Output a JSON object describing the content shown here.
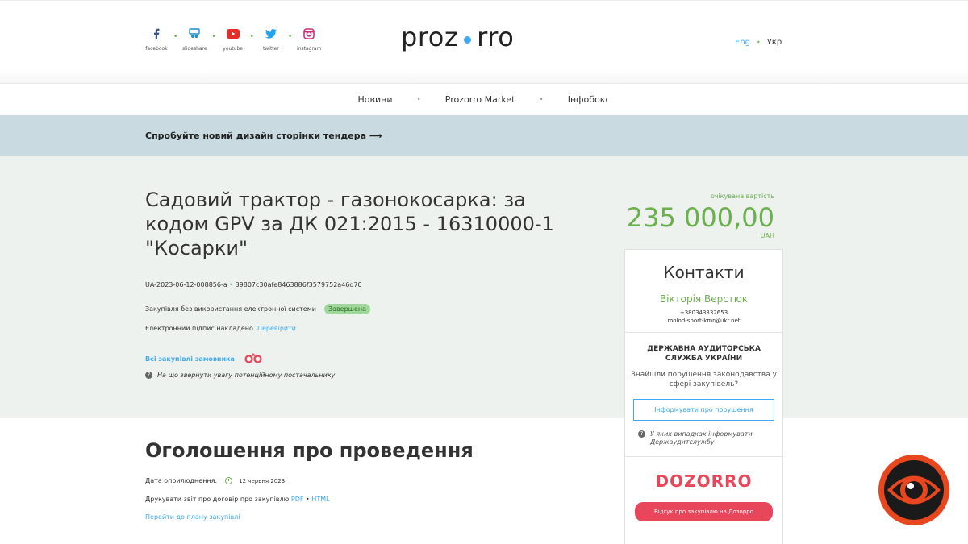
{
  "header": {
    "social": [
      {
        "label": "facebook",
        "icon": "facebook-icon",
        "color": "#3b5998"
      },
      {
        "label": "slideshare",
        "icon": "slideshare-icon",
        "color": "#1f8fc9"
      },
      {
        "label": "youtube",
        "icon": "youtube-icon",
        "color": "#e52d27"
      },
      {
        "label": "twitter",
        "icon": "twitter-icon",
        "color": "#1da1f2"
      },
      {
        "label": "instagram",
        "icon": "instagram-icon",
        "color": "#c13584"
      }
    ],
    "logo_left": "proz",
    "logo_right": "rro",
    "lang_en": "Eng",
    "lang_sep": "•",
    "lang_uk": "Укр"
  },
  "nav": {
    "items": [
      "Новини",
      "Prozorro Market",
      "Інфобокс"
    ],
    "dot": "•"
  },
  "banner": {
    "text": "Спробуйте новий дизайн сторінки тендера ⟶"
  },
  "tender": {
    "title": "Садовий трактор - газонокосарка: за кодом GPV за ДК 021:2015 - 16310000-1 \"Косарки\"",
    "id": "UA-2023-06-12-008856-a",
    "id_sep": "•",
    "hash": "39807c30afe8463886f3579752a46d70",
    "mode": "Закупівля без використання електронної системи",
    "status": "Завершена",
    "sign_text": "Електронний підпис накладено.",
    "sign_link": "Перевірити",
    "all_link": "Всі закупівлі замовника",
    "hint": "На що звернути увагу потенційному постачальнику",
    "price_label": "очікувана вартість",
    "price_value": "235 000,00",
    "price_currency": "UAH"
  },
  "contacts": {
    "title": "Контакти",
    "name": "Вікторія Верстюк",
    "phone": "+380343332653",
    "email": "molod-sport-kmr@ukr.net",
    "org": "ДЕРЖАВНА АУДИТОРСЬКА СЛУЖБА УКРАЇНИ",
    "question": "Знайшли порушення законодавства у сфері закупівель?",
    "report_button": "Інформувати про порушення",
    "note": "У яких випадках інформувати Держаудитслужбу",
    "dozorro": "DOZORRO",
    "dozorro_button": "Відгук про закупівлю на Дозорро"
  },
  "announcement": {
    "title": "Оголошення про проведення",
    "pub_label": "Дата оприлюднення:",
    "pub_date": "12 червня 2023",
    "report_text": "Друкувати звіт про договір про закупівлю",
    "report_pdf": "PDF",
    "report_sep": "•",
    "report_html": "HTML",
    "plan_link": "Перейти до плану закупівлі"
  },
  "colors": {
    "accent_green": "#6ab04c",
    "link_blue": "#3fa9f5",
    "dozorro_red": "#e8465a",
    "banner_bg": "#c9dbe1",
    "main_bg": "#edf2ef"
  }
}
